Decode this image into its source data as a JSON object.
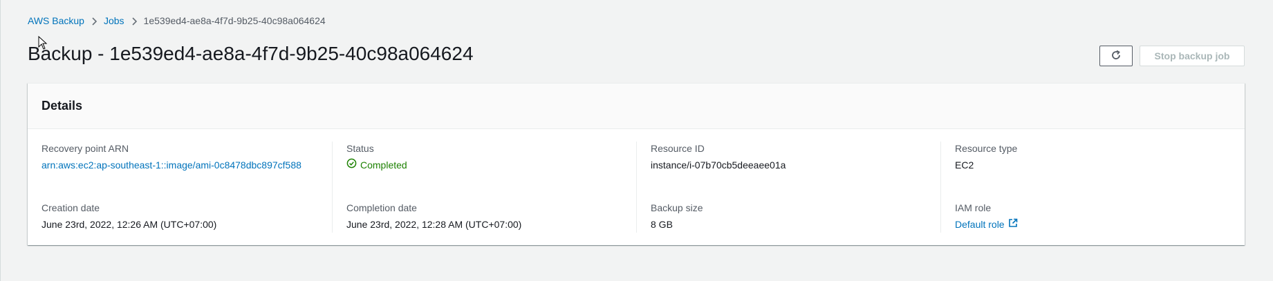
{
  "breadcrumb": {
    "items": [
      {
        "label": "AWS Backup"
      },
      {
        "label": "Jobs"
      },
      {
        "label": "1e539ed4-ae8a-4f7d-9b25-40c98a064624"
      }
    ]
  },
  "page": {
    "title": "Backup - 1e539ed4-ae8a-4f7d-9b25-40c98a064624"
  },
  "actions": {
    "refresh_icon": "refresh-icon",
    "stop_label": "Stop backup job"
  },
  "details": {
    "heading": "Details",
    "fields": [
      {
        "label": "Recovery point ARN",
        "value": "arn:aws:ec2:ap-southeast-1::image/ami-0c8478dbc897cf588"
      },
      {
        "label": "Status",
        "value": "Completed"
      },
      {
        "label": "Resource ID",
        "value": "instance/i-07b70cb5deeaee01a"
      },
      {
        "label": "Resource type",
        "value": "EC2"
      },
      {
        "label": "Creation date",
        "value": "June 23rd, 2022, 12:26 AM (UTC+07:00)"
      },
      {
        "label": "Completion date",
        "value": "June 23rd, 2022, 12:28 AM (UTC+07:00)"
      },
      {
        "label": "Backup size",
        "value": "8 GB"
      },
      {
        "label": "IAM role",
        "value": "Default role"
      }
    ]
  },
  "colors": {
    "link": "#0073bb",
    "success": "#1d8102",
    "background": "#f2f3f3"
  }
}
